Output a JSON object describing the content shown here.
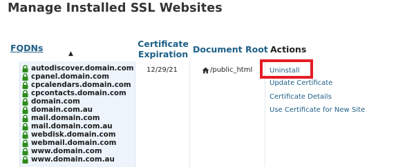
{
  "page": {
    "title": "Manage Installed SSL Websites"
  },
  "table": {
    "headers": {
      "fqdns": "FQDNs",
      "cert_expiration_line1": "Certificate",
      "cert_expiration_line2": "Expiration",
      "document_root": "Document Root",
      "actions": "Actions"
    },
    "sort_indicator": "▲",
    "row": {
      "fqdns": [
        "autodiscover.domain.com",
        "cpanel.domain.com",
        "cpcalendars.domain.com",
        "cpcontacts.domain.com",
        "domain.com",
        "domain.com.au",
        "mail.domain.com",
        "mail.domain.com.au",
        "webdisk.domain.com",
        "webmail.domain.com",
        "www.domain.com",
        "www.domain.com.au"
      ],
      "expiration": "12/29/21",
      "document_root": "/public_html",
      "actions": [
        "Uninstall",
        "Update Certificate",
        "Certificate Details",
        "Use Certificate for New Site"
      ]
    }
  },
  "icons": {
    "lock": "lock-icon",
    "home": "home-icon"
  },
  "colors": {
    "link": "#1d5f86",
    "lock": "#2e8b1a",
    "highlight": "#e31e25",
    "fqdn_cell_bg": "#edf4fc"
  }
}
